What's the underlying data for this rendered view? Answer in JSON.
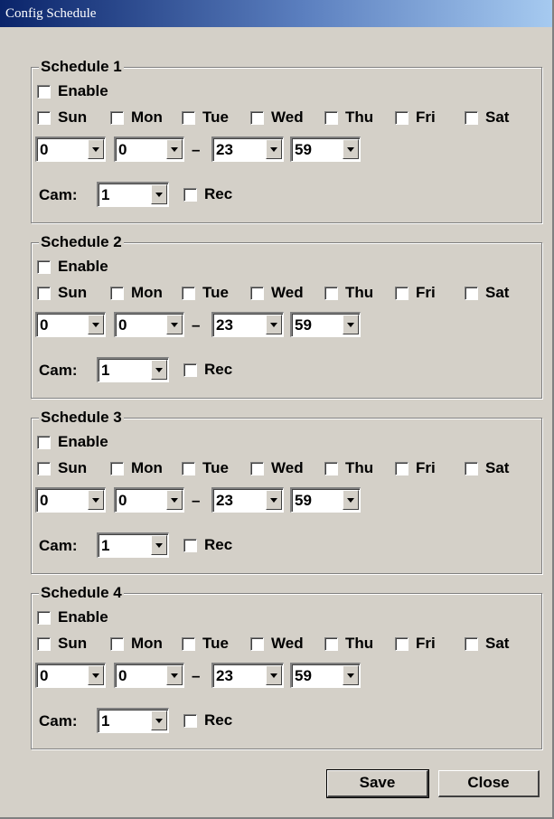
{
  "window": {
    "title": "Config Schedule"
  },
  "labels": {
    "enable": "Enable",
    "cam": "Cam:",
    "rec": "Rec",
    "range_separator": "–"
  },
  "days": [
    "Sun",
    "Mon",
    "Tue",
    "Wed",
    "Thu",
    "Fri",
    "Sat"
  ],
  "schedules": [
    {
      "title": "Schedule 1",
      "start_hour": "0",
      "start_min": "0",
      "end_hour": "23",
      "end_min": "59",
      "cam": "1"
    },
    {
      "title": "Schedule 2",
      "start_hour": "0",
      "start_min": "0",
      "end_hour": "23",
      "end_min": "59",
      "cam": "1"
    },
    {
      "title": "Schedule 3",
      "start_hour": "0",
      "start_min": "0",
      "end_hour": "23",
      "end_min": "59",
      "cam": "1"
    },
    {
      "title": "Schedule 4",
      "start_hour": "0",
      "start_min": "0",
      "end_hour": "23",
      "end_min": "59",
      "cam": "1"
    }
  ],
  "buttons": {
    "save": "Save",
    "close": "Close"
  }
}
